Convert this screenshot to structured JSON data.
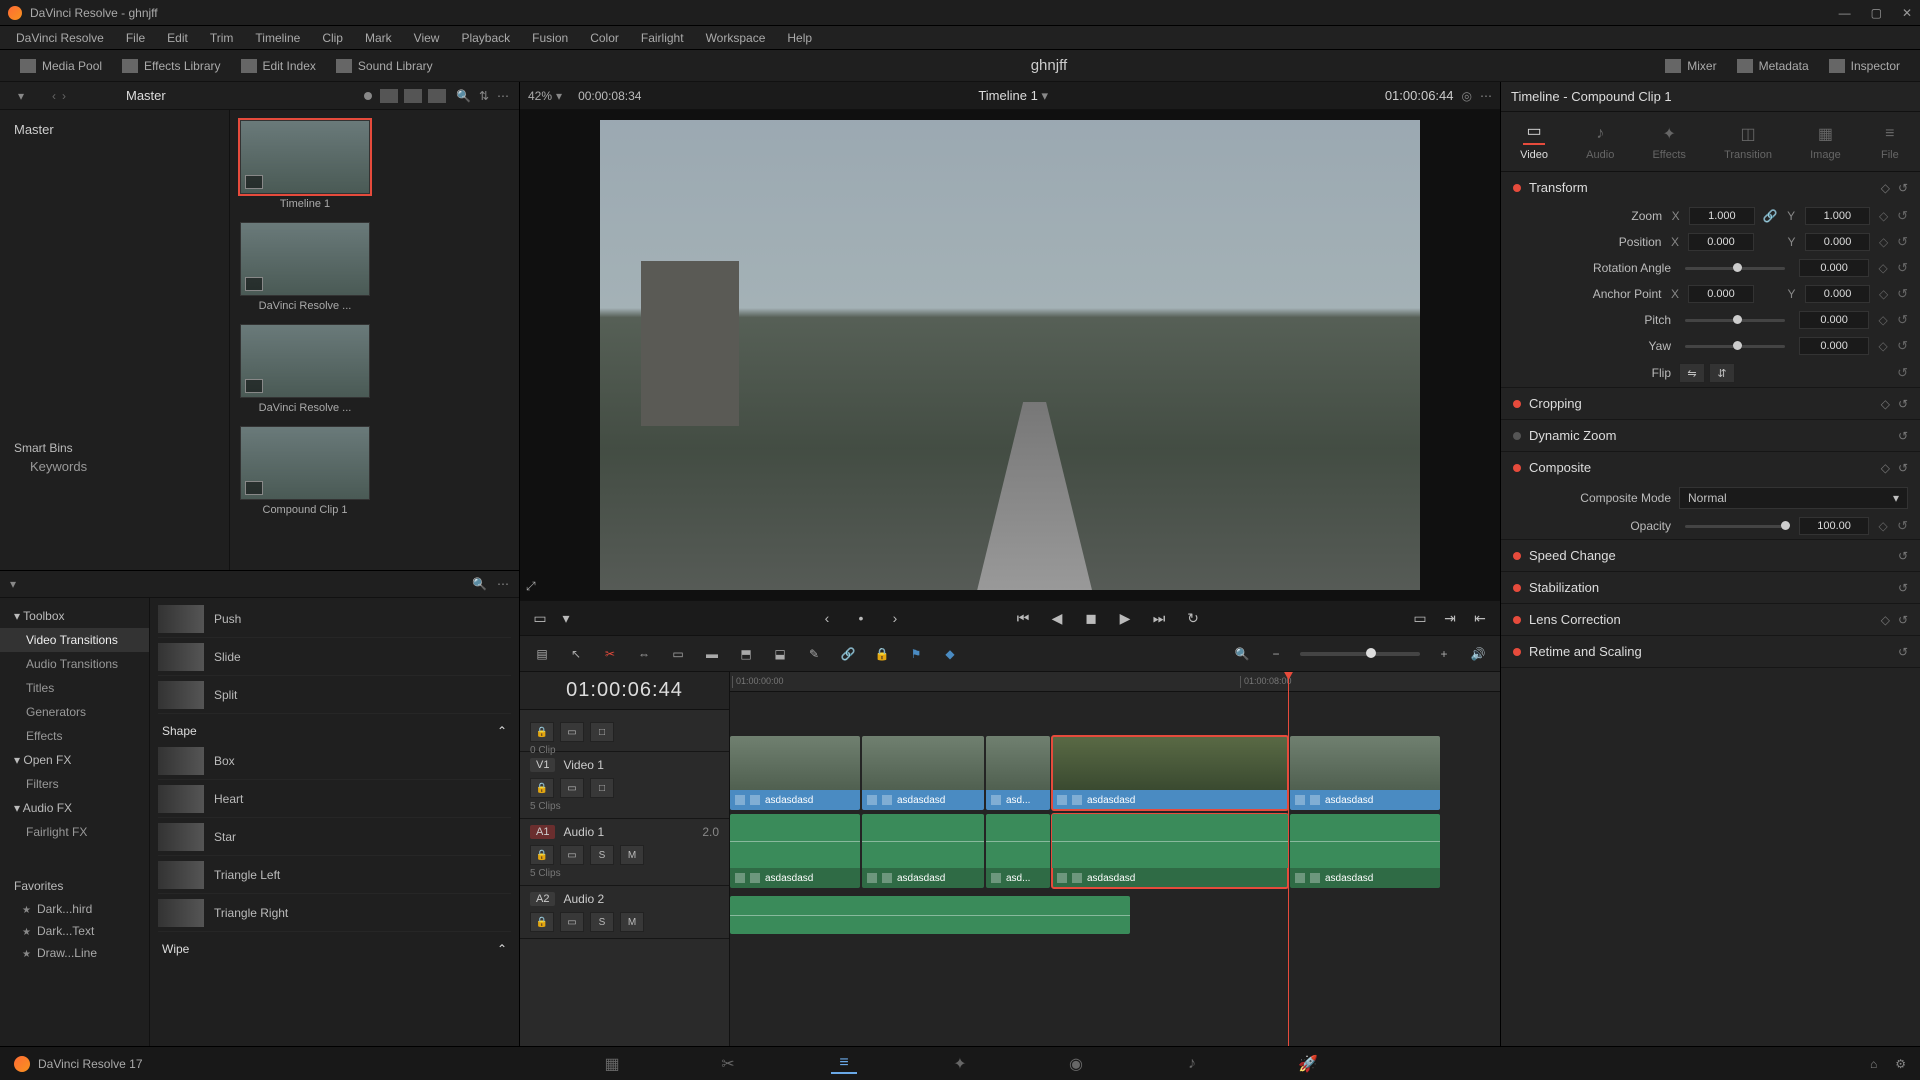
{
  "app": {
    "title": "DaVinci Resolve - ghnjff",
    "project": "ghnjff",
    "version": "DaVinci Resolve 17"
  },
  "win_controls": {
    "min": "—",
    "max": "▢",
    "close": "✕"
  },
  "menu": [
    "DaVinci Resolve",
    "File",
    "Edit",
    "Trim",
    "Timeline",
    "Clip",
    "Mark",
    "View",
    "Playback",
    "Fusion",
    "Color",
    "Fairlight",
    "Workspace",
    "Help"
  ],
  "toolbar": {
    "media_pool": "Media Pool",
    "effects": "Effects Library",
    "edit_index": "Edit Index",
    "sound": "Sound Library",
    "mixer": "Mixer",
    "metadata": "Metadata",
    "inspector": "Inspector"
  },
  "bin": {
    "master": "Master",
    "tree_master": "Master",
    "smart_bins": "Smart Bins",
    "keywords": "Keywords",
    "thumbs": [
      {
        "label": "Timeline 1",
        "selected": true
      },
      {
        "label": "DaVinci Resolve ...",
        "selected": false
      },
      {
        "label": "DaVinci Resolve ...",
        "selected": false
      },
      {
        "label": "Compound Clip 1",
        "selected": false
      }
    ]
  },
  "viewer": {
    "zoom": "42%",
    "src_tc": "00:00:08:34",
    "timeline_name": "Timeline 1",
    "rec_tc": "01:00:06:44"
  },
  "fx": {
    "nav": {
      "toolbox": "Toolbox",
      "video_trans": "Video Transitions",
      "audio_trans": "Audio Transitions",
      "titles": "Titles",
      "generators": "Generators",
      "effects": "Effects",
      "openfx": "Open FX",
      "filters": "Filters",
      "audiofx": "Audio FX",
      "fairlight": "Fairlight FX",
      "favorites": "Favorites",
      "fav_items": [
        "Dark...hird",
        "Dark...Text",
        "Draw...Line"
      ]
    },
    "list": {
      "top": [
        "Push",
        "Slide",
        "Split"
      ],
      "shape_hdr": "Shape",
      "shape": [
        "Box",
        "Heart",
        "Star",
        "Triangle Left",
        "Triangle Right"
      ],
      "wipe_hdr": "Wipe"
    }
  },
  "timeline": {
    "tc": "01:00:06:44",
    "ruler": [
      "01:00:00:00",
      "01:00:08:00"
    ],
    "tracks": {
      "v1": {
        "tag": "V1",
        "name": "Video 1",
        "note": "5 Clips"
      },
      "a1": {
        "tag": "A1",
        "name": "Audio 1",
        "ch": "2.0",
        "note": "5 Clips"
      },
      "a2": {
        "tag": "A2",
        "name": "Audio 2"
      }
    },
    "clip_name": "asdasdasd",
    "clip_name_short": "asd..."
  },
  "inspector": {
    "title": "Timeline - Compound Clip 1",
    "tabs": {
      "video": "Video",
      "audio": "Audio",
      "effects": "Effects",
      "transition": "Transition",
      "image": "Image",
      "file": "File"
    },
    "transform": {
      "hdr": "Transform",
      "zoom": "Zoom",
      "zx": "1.000",
      "zy": "1.000",
      "position": "Position",
      "px": "0.000",
      "py": "0.000",
      "rotation": "Rotation Angle",
      "rv": "0.000",
      "anchor": "Anchor Point",
      "ax": "0.000",
      "ay": "0.000",
      "pitch": "Pitch",
      "pv": "0.000",
      "yaw": "Yaw",
      "yv": "0.000",
      "flip": "Flip"
    },
    "cropping": "Cropping",
    "dynzoom": "Dynamic Zoom",
    "composite": {
      "hdr": "Composite",
      "mode_l": "Composite Mode",
      "mode_v": "Normal",
      "opacity_l": "Opacity",
      "opacity_v": "100.00"
    },
    "speed": "Speed Change",
    "stab": "Stabilization",
    "lens": "Lens Correction",
    "retime": "Retime and Scaling"
  },
  "axis": {
    "x": "X",
    "y": "Y"
  },
  "btn": {
    "s": "S",
    "m": "M",
    "lock": "🔒",
    "eye": "▭",
    "mode": "□"
  }
}
